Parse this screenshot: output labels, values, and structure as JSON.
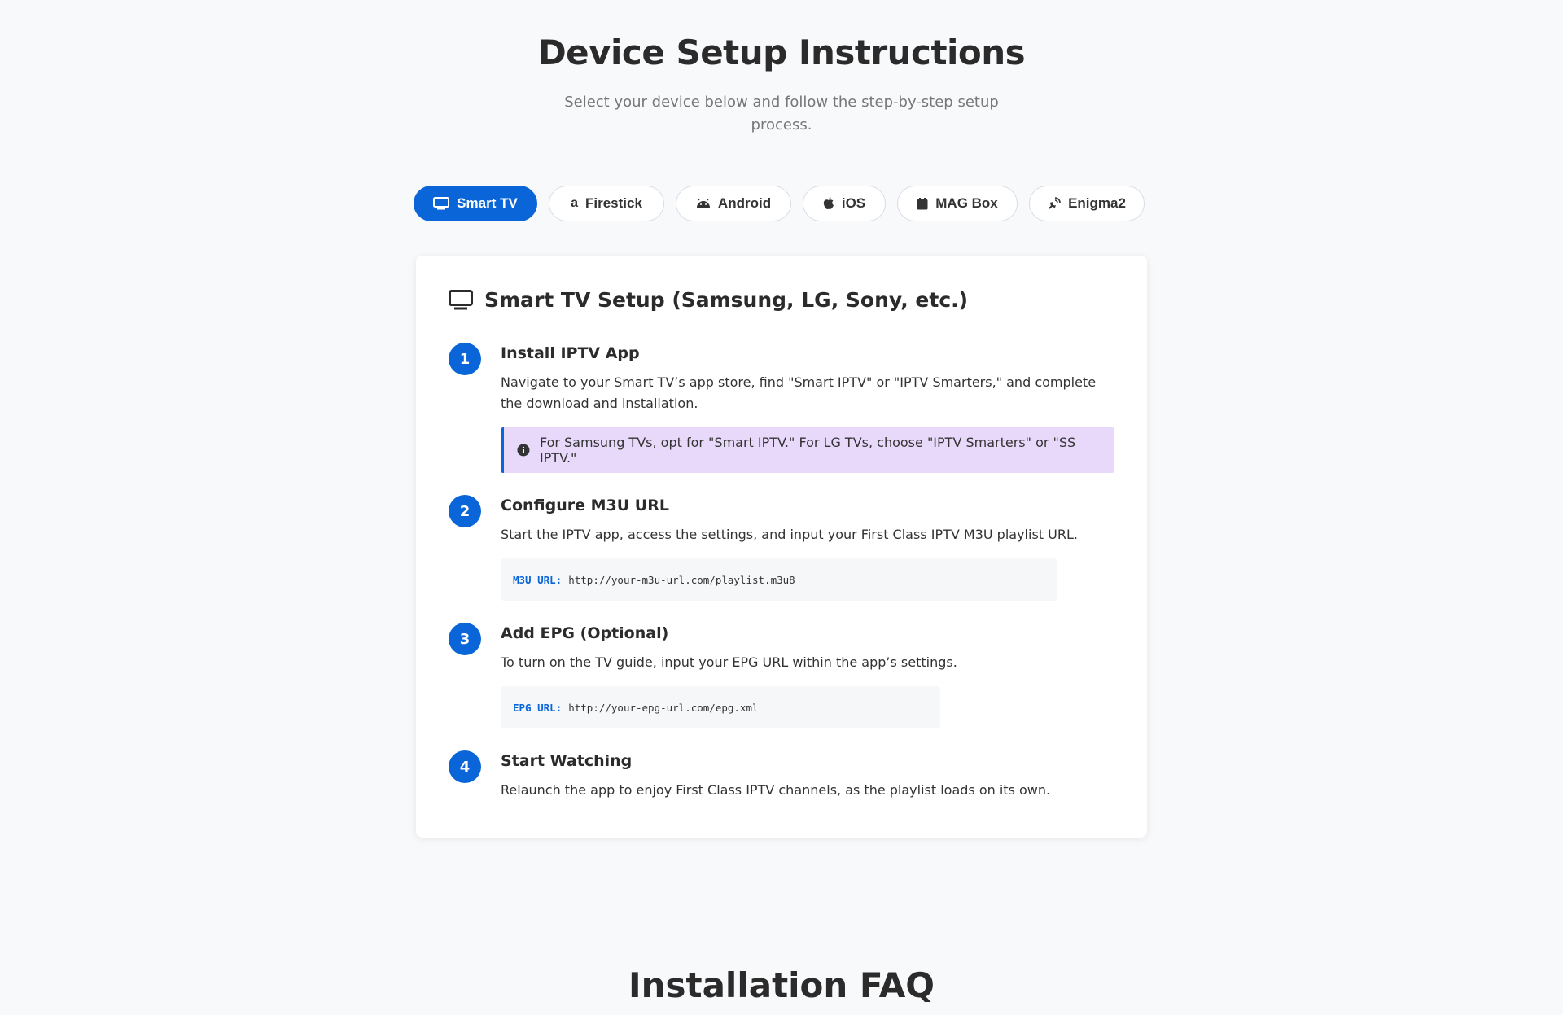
{
  "header": {
    "title": "Device Setup Instructions",
    "subtitle": "Select your device below and follow the step-by-step setup process."
  },
  "tabs": [
    {
      "label": "Smart TV",
      "icon": "tv-icon",
      "active": true
    },
    {
      "label": "Firestick",
      "icon": "amazon-icon",
      "active": false
    },
    {
      "label": "Android",
      "icon": "android-icon",
      "active": false
    },
    {
      "label": "iOS",
      "icon": "apple-icon",
      "active": false
    },
    {
      "label": "MAG Box",
      "icon": "box-icon",
      "active": false
    },
    {
      "label": "Enigma2",
      "icon": "satellite-icon",
      "active": false
    }
  ],
  "card": {
    "title": "Smart TV Setup (Samsung, LG, Sony, etc.)",
    "icon": "tv-icon",
    "steps": [
      {
        "number": "1",
        "title": "Install IPTV App",
        "text": "Navigate to your Smart TV’s app store, find \"Smart IPTV\" or \"IPTV Smarters,\" and complete the download and installation.",
        "note": "For Samsung TVs, opt for \"Smart IPTV.\" For LG TVs, choose \"IPTV Smarters\" or \"SS IPTV.\""
      },
      {
        "number": "2",
        "title": "Configure M3U URL",
        "text": "Start the IPTV app, access the settings, and input your First Class IPTV M3U playlist URL.",
        "code_label": "M3U URL:",
        "code_value": "http://your-m3u-url.com/playlist.m3u8"
      },
      {
        "number": "3",
        "title": "Add EPG (Optional)",
        "text": "To turn on the TV guide, input your EPG URL within the app’s settings.",
        "code_label": "EPG URL:",
        "code_value": "http://your-epg-url.com/epg.xml"
      },
      {
        "number": "4",
        "title": "Start Watching",
        "text": "Relaunch the app to enjoy First Class IPTV channels, as the playlist loads on its own."
      }
    ]
  },
  "faq": {
    "title": "Installation FAQ"
  },
  "colors": {
    "accent": "#0a66d8",
    "note_bg": "#e8d9fb",
    "page_bg": "#f8f9fb"
  }
}
